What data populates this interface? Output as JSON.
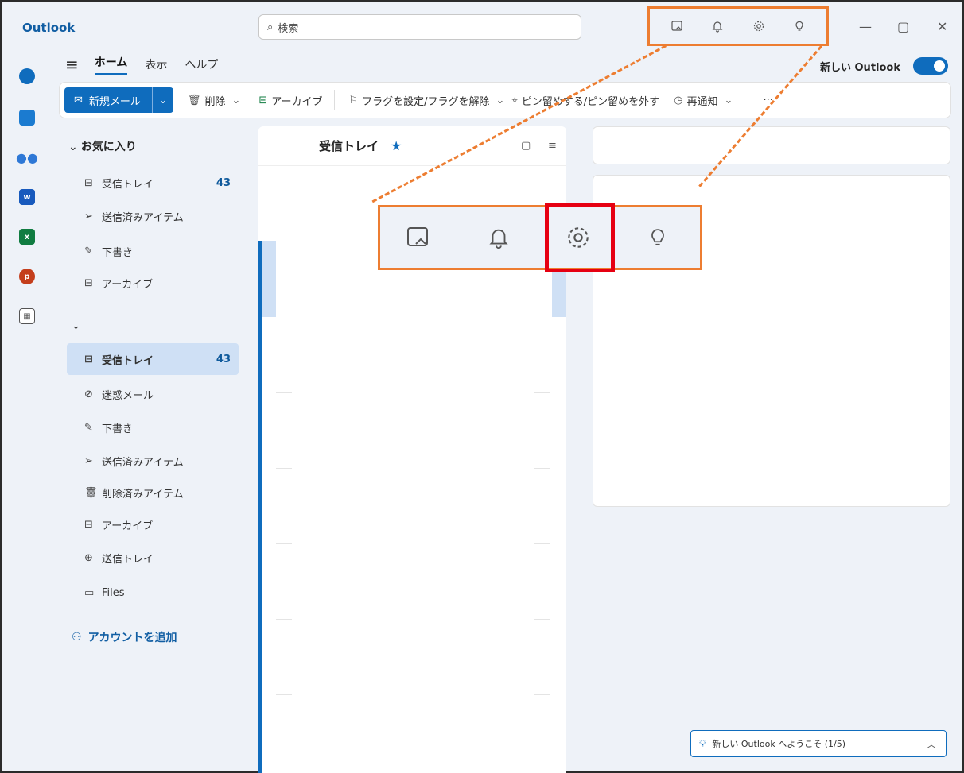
{
  "app": {
    "title": "Outlook"
  },
  "search": {
    "placeholder": "検索"
  },
  "titlebar_icons": [
    "my-day-icon",
    "bell-icon",
    "gear-icon",
    "lightbulb-icon"
  ],
  "window_controls": {
    "minimize": "—",
    "maximize": "▢",
    "close": "✕"
  },
  "rail": [
    {
      "name": "mail",
      "color": "#0f6cbd"
    },
    {
      "name": "calendar",
      "color": "#1b7bd0"
    },
    {
      "name": "people",
      "color": "#2e78d6"
    },
    {
      "name": "word",
      "color": "#185abd",
      "label": "w"
    },
    {
      "name": "excel",
      "color": "#107c41",
      "label": "x"
    },
    {
      "name": "powerpoint",
      "color": "#c43e1c",
      "label": "p"
    },
    {
      "name": "apps",
      "color": "#555555"
    }
  ],
  "ribbon": {
    "tabs": [
      "ホーム",
      "表示",
      "ヘルプ"
    ],
    "new_outlook_label": "新しい Outlook",
    "new_mail": "新規メール",
    "delete": "削除",
    "archive": "アーカイブ",
    "flag": "フラグを設定/フラグを解除",
    "pin": "ピン留めする/ピン留めを外す",
    "remind": "再通知",
    "more": "···"
  },
  "folders": {
    "favorites_header": "お気に入り",
    "favorites": [
      {
        "label": "受信トレイ",
        "count": "43",
        "icon": "inbox-icon"
      },
      {
        "label": "送信済みアイテム",
        "icon": "send-icon"
      },
      {
        "label": "下書き",
        "icon": "draft-icon"
      },
      {
        "label": "アーカイブ",
        "icon": "archive-icon"
      }
    ],
    "account": [
      {
        "label": "受信トレイ",
        "count": "43",
        "icon": "inbox-icon",
        "selected": true
      },
      {
        "label": "迷惑メール",
        "icon": "junk-icon"
      },
      {
        "label": "下書き",
        "icon": "draft-icon"
      },
      {
        "label": "送信済みアイテム",
        "icon": "send-icon"
      },
      {
        "label": "削除済みアイテム",
        "icon": "trash-icon"
      },
      {
        "label": "アーカイブ",
        "icon": "archive-icon"
      },
      {
        "label": "送信トレイ",
        "icon": "outbox-icon"
      },
      {
        "label": "Files",
        "icon": "folder-icon"
      }
    ],
    "add_account": "アカウントを追加"
  },
  "message_list": {
    "title": "受信トレイ"
  },
  "welcome": {
    "text": "新しい Outlook へようこそ (1/5)"
  },
  "colors": {
    "accent": "#0f6cbd",
    "callout": "#ed7d31",
    "highlight": "#e60012"
  }
}
